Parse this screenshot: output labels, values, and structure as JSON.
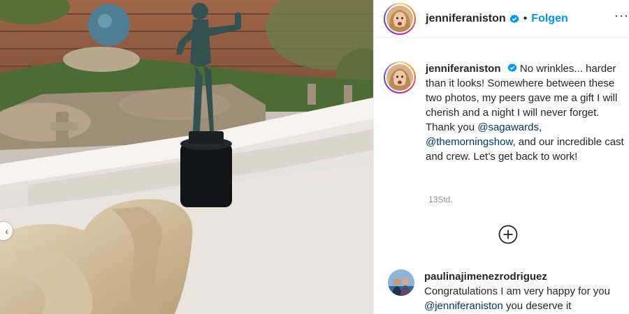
{
  "post": {
    "username": "jenniferaniston",
    "follow_label": "Folgen",
    "more_label": "···",
    "caption": {
      "part1": "No wrinkles... harder than it looks! Somewhere between these two photos, my peers gave me a gift I will cherish and a night I will never forget. Thank you ",
      "mention1": "@sagawards",
      "sep": ", ",
      "mention2": "@themorningshow",
      "part2": ", and our incredible cast and crew. Let’s get back to work!"
    },
    "timestamp": "13Std."
  },
  "comment": {
    "username": "paulinajimenezrodriguez",
    "text_before": "Congratulations I am very happy for you ",
    "mention": "@jenniferaniston",
    "text_after": " you deserve it"
  },
  "icons": {
    "verified": "verified-badge-icon",
    "load_more": "plus-circle-icon",
    "carousel_prev": "chevron-left-icon"
  },
  "colors": {
    "link_blue": "#0095f6",
    "mention_blue": "#00376b",
    "verified_blue": "#0095f6"
  }
}
